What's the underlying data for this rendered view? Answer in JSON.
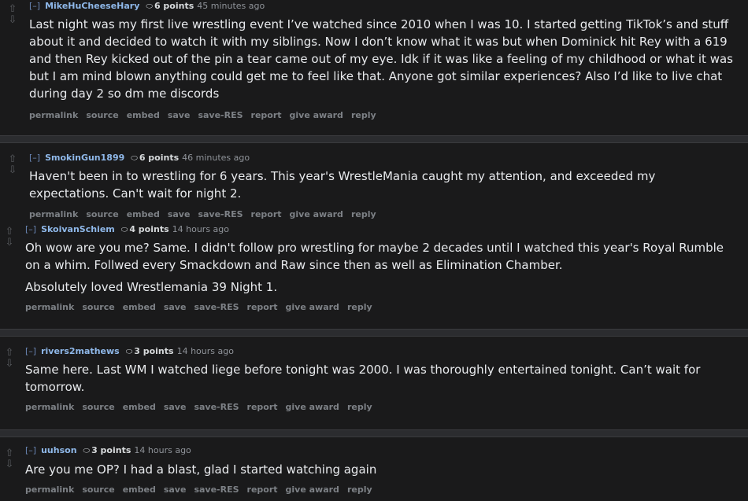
{
  "actions": [
    "permalink",
    "source",
    "embed",
    "save",
    "save-RES",
    "report",
    "give award",
    "reply"
  ],
  "comments": [
    {
      "toggle": "[–]",
      "author": "MikeHuCheeseHary",
      "score": "6 points",
      "time": "45 minutes ago",
      "paragraphs": [
        "Last night was my first live wrestling event I’ve watched since 2010 when I was 10. I started getting TikTok’s and stuff about it and decided to watch it with my siblings. Now I don’t know what it was but when Dominick hit Rey with a 619 and then Rey kicked out of the pin a tear came out of my eye. Idk if it was like a feeling of my childhood or what it was but I am mind blown anything could get me to feel like that. Anyone got similar experiences? Also I’d like to live chat during day 2 so dm me discords"
      ]
    },
    {
      "toggle": "[–]",
      "author": "SmokinGun1899",
      "score": "6 points",
      "time": "46 minutes ago",
      "paragraphs": [
        "Haven't been in to wrestling for 6 years. This year's WrestleMania caught my attention, and exceeded my expectations. Can't wait for night 2."
      ]
    },
    {
      "toggle": "[–]",
      "author": "SkoivanSchiem",
      "score": "4 points",
      "time": "14 hours ago",
      "paragraphs": [
        "Oh wow are you me? Same. I didn't follow pro wrestling for maybe 2 decades until I watched this year's Royal Rumble on a whim. Follwed every Smackdown and Raw since then as well as Elimination Chamber.",
        "Absolutely loved Wrestlemania 39 Night 1."
      ]
    },
    {
      "toggle": "[–]",
      "author": "rivers2mathews",
      "score": "3 points",
      "time": "14 hours ago",
      "paragraphs": [
        "Same here. Last WM I watched liege before tonight was 2000. I was thoroughly entertained tonight. Can’t wait for tomorrow."
      ]
    },
    {
      "toggle": "[–]",
      "author": "uuhson",
      "score": "3 points",
      "time": "14 hours ago",
      "paragraphs": [
        "Are you me OP? I had a blast, glad I started watching again"
      ]
    }
  ]
}
